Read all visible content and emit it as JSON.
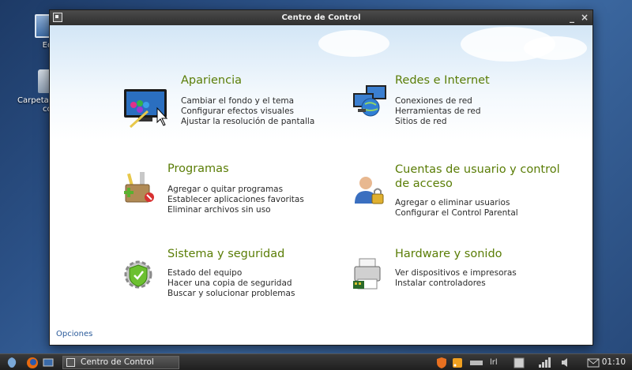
{
  "desktop": {
    "icons": [
      {
        "label": "Eq"
      },
      {
        "label": "Carpeta"
      },
      {
        "label": "co"
      }
    ]
  },
  "window": {
    "title": "Centro de Control",
    "minimize": "_",
    "close": "×"
  },
  "sections": [
    {
      "title": "Apariencia",
      "icon": "appearance-monitor-icon",
      "links": [
        "Cambiar el fondo y el tema",
        "Configurar efectos visuales",
        "Ajustar la resolución de pantalla"
      ]
    },
    {
      "title": "Redes e Internet",
      "icon": "network-globe-icon",
      "links": [
        "Conexiones de red",
        "Herramientas de red",
        "Sitios de red"
      ]
    },
    {
      "title": "Programas",
      "icon": "programs-box-icon",
      "links": [
        "Agregar o quitar programas",
        "Establecer aplicaciones favoritas",
        "Eliminar archivos sin uso"
      ]
    },
    {
      "title_line1": "Cuentas de usuario y control",
      "title_line2": "de acceso",
      "icon": "user-accounts-icon",
      "links": [
        "Agregar o eliminar usuarios",
        "Configurar el Control Parental"
      ]
    },
    {
      "title": "Sistema y seguridad",
      "icon": "security-shield-gear-icon",
      "links": [
        "Estado del equipo",
        "Hacer una copia de seguridad",
        "Buscar y solucionar problemas"
      ]
    },
    {
      "title": "Hardware y sonido",
      "icon": "printer-hardware-icon",
      "links": [
        "Ver dispositivos e impresoras",
        "Instalar controladores"
      ]
    }
  ],
  "footer": {
    "options": "Opciones"
  },
  "taskbar": {
    "task_label": "Centro de Control",
    "keyboard_layout": "lrl",
    "clock": "01:10"
  },
  "colors": {
    "section_title": "#5a7d06",
    "link_text": "#2b2b2b",
    "options_link": "#2a5a9a"
  }
}
